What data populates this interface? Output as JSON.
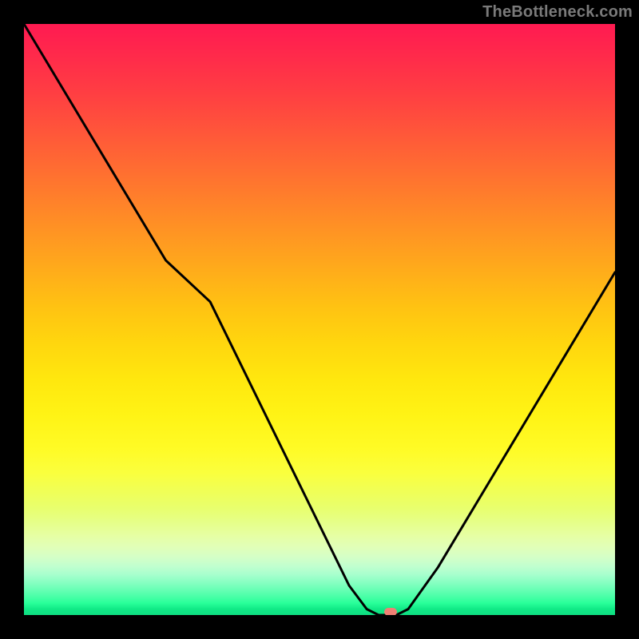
{
  "watermark": {
    "text": "TheBottleneck.com"
  },
  "chart_data": {
    "type": "line",
    "title": "",
    "xlabel": "",
    "ylabel": "",
    "xlim": [
      0,
      100
    ],
    "ylim": [
      0,
      100
    ],
    "grid": false,
    "legend": false,
    "colors": {
      "line": "#000000",
      "marker": "#f08074",
      "gradient_top": "#ff1a51",
      "gradient_mid": "#ffe70e",
      "gradient_bottom": "#0fde82"
    },
    "series": [
      {
        "name": "bottleneck-curve",
        "x": [
          0,
          6,
          12,
          18,
          24,
          31.5,
          55,
          58,
          60,
          63,
          65,
          70,
          76,
          82,
          88,
          94,
          100
        ],
        "values": [
          100,
          90,
          80,
          70,
          60,
          53,
          5,
          1,
          0,
          0,
          1,
          8,
          18,
          28,
          38,
          48,
          58
        ]
      }
    ],
    "marker": {
      "x": 62,
      "y": 0.5
    }
  }
}
